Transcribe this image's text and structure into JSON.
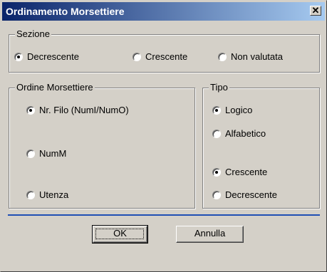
{
  "window": {
    "title": "Ordinamento Morsettiere"
  },
  "titlebar": {
    "close_glyph": "✕",
    "close_icon": "close-icon"
  },
  "sezione": {
    "label": "Sezione",
    "options": [
      {
        "label": "Decrescente",
        "checked": true
      },
      {
        "label": "Crescente",
        "checked": false
      },
      {
        "label": "Non valutata",
        "checked": false
      }
    ]
  },
  "ordine": {
    "label": "Ordine Morsettiere",
    "options": [
      {
        "label": "Nr. Filo (NumI/NumO)",
        "checked": true
      },
      {
        "label": "NumM",
        "checked": false
      },
      {
        "label": "Utenza",
        "checked": false
      }
    ]
  },
  "tipo": {
    "label": "Tipo",
    "options": [
      {
        "label": "Logico",
        "checked": true
      },
      {
        "label": "Alfabetico",
        "checked": false
      },
      {
        "label": "Crescente",
        "checked": true
      },
      {
        "label": "Decrescente",
        "checked": false
      }
    ]
  },
  "buttons": {
    "ok": "OK",
    "cancel": "Annulla"
  },
  "colors": {
    "title_start": "#0a246a",
    "title_end": "#a6caf0",
    "separator": "#1f4fb4",
    "face": "#d4d0c8"
  }
}
